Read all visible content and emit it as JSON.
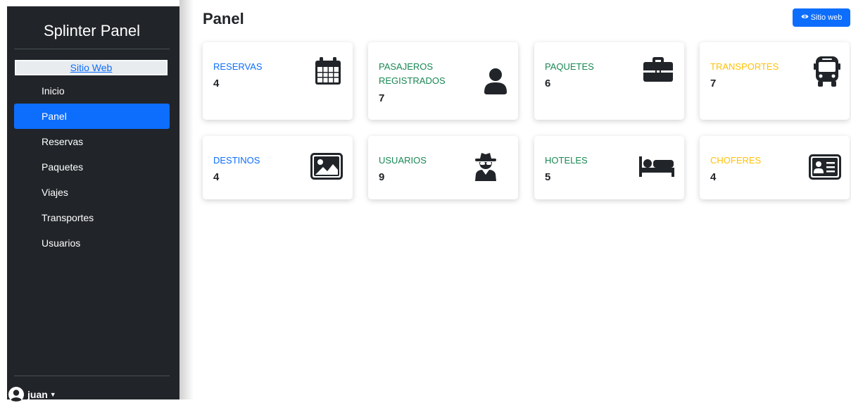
{
  "sidebar": {
    "brand": "Splinter Panel",
    "site_link": "Sitio Web",
    "items": [
      {
        "label": "Inicio",
        "active": false
      },
      {
        "label": "Panel",
        "active": true
      },
      {
        "label": "Reservas",
        "active": false
      },
      {
        "label": "Paquetes",
        "active": false
      },
      {
        "label": "Viajes",
        "active": false
      },
      {
        "label": "Transportes",
        "active": false
      },
      {
        "label": "Usuarios",
        "active": false
      }
    ],
    "user": {
      "name": "juan",
      "icon": "user-circle-icon"
    }
  },
  "header": {
    "title": "Panel",
    "button_label": "Sitio web",
    "button_icon": "eye-icon"
  },
  "colors": {
    "primary": "#0d6efd",
    "success": "#198754",
    "warning": "#ffc107",
    "dark": "#212529"
  },
  "cards": [
    {
      "label": "RESERVAS",
      "value": "4",
      "color": "#0d6efd",
      "icon": "calendar-icon"
    },
    {
      "label": "PASAJEROS REGISTRADOS",
      "value": "7",
      "color": "#198754",
      "icon": "user-icon"
    },
    {
      "label": "PAQUETES",
      "value": "6",
      "color": "#198754",
      "icon": "briefcase-icon"
    },
    {
      "label": "TRANSPORTES",
      "value": "7",
      "color": "#ffc107",
      "icon": "bus-icon"
    },
    {
      "label": "DESTINOS",
      "value": "4",
      "color": "#0d6efd",
      "icon": "image-icon"
    },
    {
      "label": "USUARIOS",
      "value": "9",
      "color": "#198754",
      "icon": "user-secret-icon"
    },
    {
      "label": "HOTELES",
      "value": "5",
      "color": "#198754",
      "icon": "bed-icon"
    },
    {
      "label": "CHOFERES",
      "value": "4",
      "color": "#ffc107",
      "icon": "id-card-icon"
    }
  ]
}
